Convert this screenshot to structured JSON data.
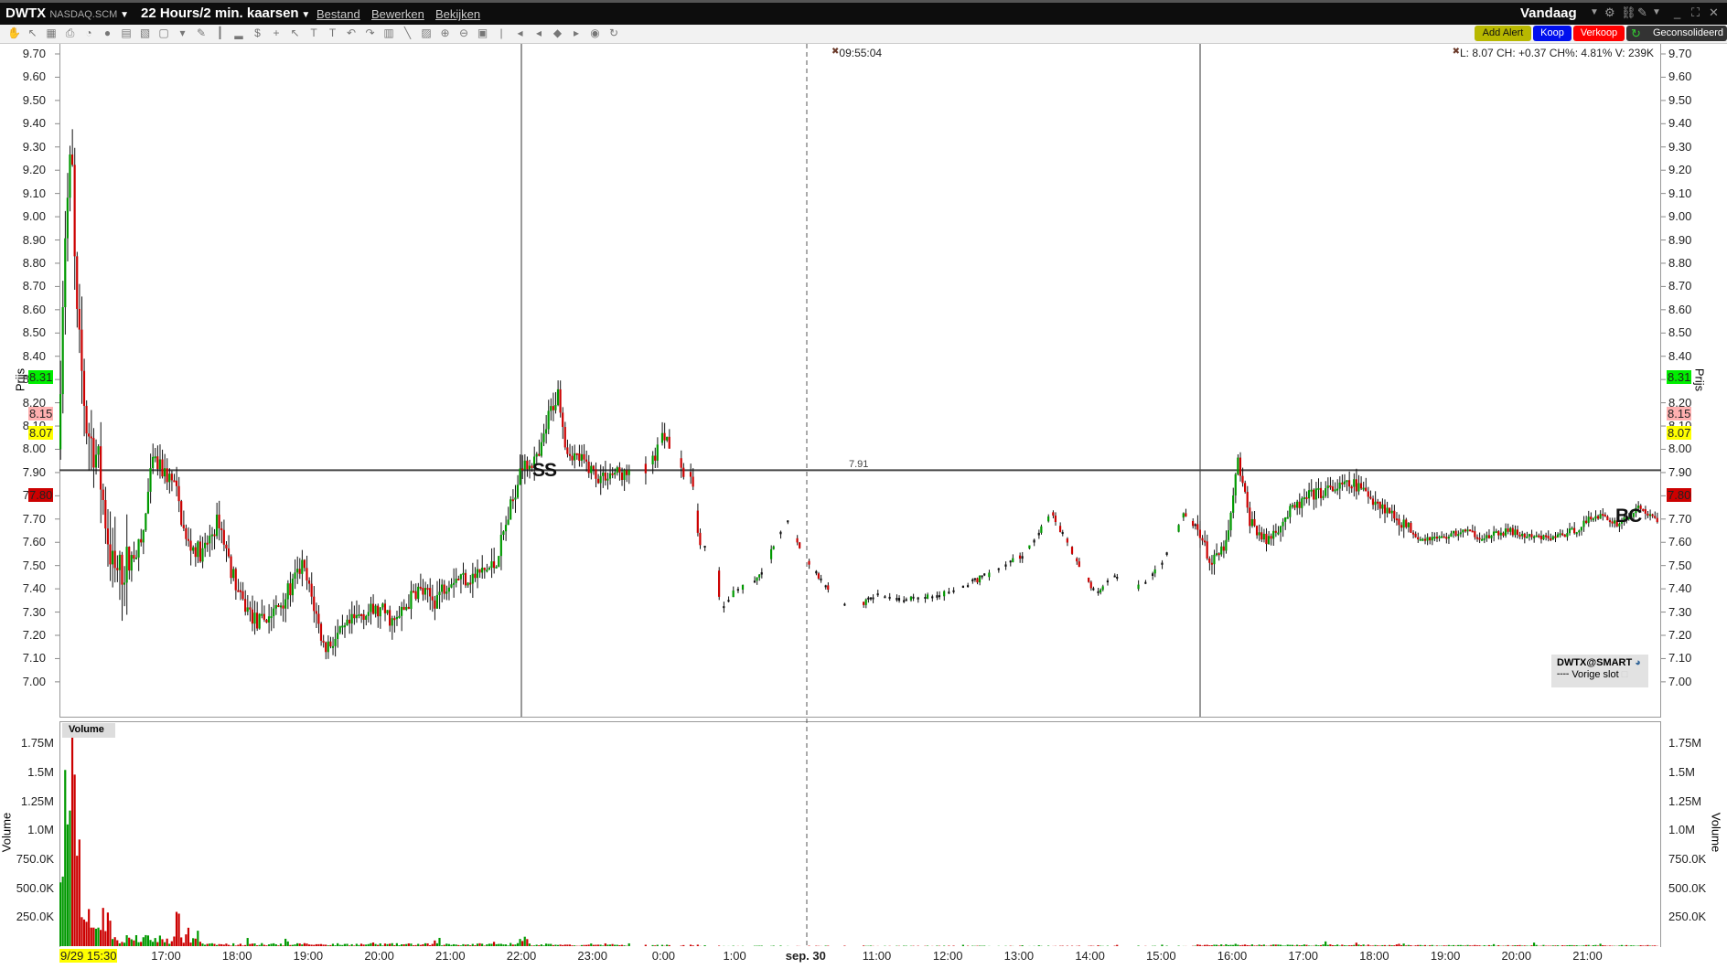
{
  "titlebar": {
    "symbol": "DWTX",
    "exchange": "NASDAQ.SCM",
    "period": "22 Hours/2 min. kaarsen",
    "menus": [
      "Bestand",
      "Bewerken",
      "Bekijken"
    ],
    "range": "Vandaag"
  },
  "toolbar_icons": [
    "hand-icon",
    "pointer-icon",
    "grid-icon",
    "print-icon",
    "clock-icon",
    "circle-icon",
    "layout-icon",
    "chart-compare-icon",
    "blank-icon",
    "dropdown-icon",
    "pencil-icon",
    "bar-type-icon",
    "volume-icon",
    "dollar-icon",
    "crosshair-icon",
    "cursor-icon",
    "text-icon",
    "text-tool-icon",
    "undo-icon",
    "redo-icon",
    "fib-icon",
    "trendline-icon",
    "channel-icon",
    "zoom-in-icon",
    "zoom-out-icon",
    "zoom-fit-icon",
    "scroll-left-icon",
    "scroll-left2-icon",
    "scroll-center-icon",
    "scroll-right-icon",
    "share-icon",
    "refresh-icon",
    "wrench-icon"
  ],
  "order_buttons": {
    "add_alert": "Add Alert",
    "buy": "Koop",
    "sell": "Verkoop",
    "consolidated": "Geconsolideerd"
  },
  "info": {
    "quote": "L: 8.07 CH: +0.37 CH%: 4.81% V: 239K",
    "cursor_time": "09:55:04",
    "crosshair_price": "7.91"
  },
  "axis": {
    "price_title": "Prijs",
    "volume_title": "Volume",
    "price_ticks": [
      "9.70",
      "9.60",
      "9.50",
      "9.40",
      "9.30",
      "9.20",
      "9.10",
      "9.00",
      "8.90",
      "8.80",
      "8.70",
      "8.60",
      "8.50",
      "8.40",
      "8.30",
      "8.20",
      "8.10",
      "8.00",
      "7.90",
      "7.80",
      "7.70",
      "7.60",
      "7.50",
      "7.40",
      "7.30",
      "7.20",
      "7.10",
      "7.00"
    ],
    "volume_ticks": [
      "1.75M",
      "1.5M",
      "1.25M",
      "1.0M",
      "750.0K",
      "500.0K",
      "250.0K"
    ],
    "volume_tick_values": [
      1750000,
      1500000,
      1250000,
      1000000,
      750000,
      500000,
      250000
    ],
    "start_label": "9/29 15:30",
    "time_labels": [
      "17:00",
      "18:00",
      "19:00",
      "20:00",
      "21:00",
      "22:00",
      "23:00",
      "0:00",
      "1:00",
      "sep. 30",
      "11:00",
      "12:00",
      "13:00",
      "14:00",
      "15:00",
      "16:00",
      "17:00",
      "18:00",
      "19:00",
      "20:00",
      "21:00"
    ]
  },
  "price_badges": [
    {
      "text": "8.31",
      "price": 8.31,
      "bg": "#00ee00"
    },
    {
      "text": "8.15",
      "price": 8.15,
      "bg": "#ffb0b0"
    },
    {
      "text": "8.07",
      "price": 8.07,
      "bg": "#ffff00"
    },
    {
      "text": "7.80",
      "price": 7.8,
      "bg": "#cc0000"
    }
  ],
  "annotations": {
    "ss": "SS",
    "bc": "BC"
  },
  "legend": {
    "title": "DWTX@SMART",
    "prev_close": "Vorige slot"
  },
  "volume_label": "Volume",
  "colors": {
    "up": "#009900",
    "down": "#cc0000"
  },
  "chart_data": {
    "type": "candlestick",
    "interval_minutes": 2,
    "price_range": [
      6.9,
      9.72
    ],
    "price_path_hours_price": [
      [
        0,
        8.0
      ],
      [
        0.09,
        8.9
      ],
      [
        0.19,
        9.3
      ],
      [
        0.25,
        8.6
      ],
      [
        0.4,
        8.1
      ],
      [
        0.56,
        7.95
      ],
      [
        0.71,
        7.6
      ],
      [
        0.79,
        7.45
      ],
      [
        0.95,
        7.5
      ],
      [
        1.18,
        7.6
      ],
      [
        1.33,
        7.95
      ],
      [
        1.49,
        7.9
      ],
      [
        1.64,
        7.85
      ],
      [
        1.8,
        7.6
      ],
      [
        2.03,
        7.55
      ],
      [
        2.26,
        7.7
      ],
      [
        2.42,
        7.5
      ],
      [
        2.57,
        7.35
      ],
      [
        2.81,
        7.25
      ],
      [
        3.04,
        7.3
      ],
      [
        3.27,
        7.4
      ],
      [
        3.43,
        7.5
      ],
      [
        3.58,
        7.35
      ],
      [
        3.74,
        7.15
      ],
      [
        3.97,
        7.2
      ],
      [
        4.28,
        7.3
      ],
      [
        4.59,
        7.3
      ],
      [
        4.74,
        7.25
      ],
      [
        5.05,
        7.4
      ],
      [
        5.29,
        7.35
      ],
      [
        5.52,
        7.45
      ],
      [
        5.83,
        7.45
      ],
      [
        6.14,
        7.5
      ],
      [
        6.37,
        7.75
      ],
      [
        6.53,
        7.95
      ],
      [
        6.76,
        7.95
      ],
      [
        6.91,
        8.15
      ],
      [
        7.04,
        8.25
      ],
      [
        7.15,
        8.0
      ],
      [
        7.38,
        7.95
      ],
      [
        7.61,
        7.88
      ],
      [
        7.84,
        7.9
      ],
      [
        8.08,
        7.88
      ],
      [
        8.31,
        7.92
      ],
      [
        8.54,
        8.07
      ],
      [
        8.7,
        7.95
      ],
      [
        8.93,
        7.85
      ],
      [
        9.01,
        7.6
      ],
      [
        9.24,
        7.55
      ],
      [
        9.32,
        7.32
      ],
      [
        9.55,
        7.4
      ],
      [
        9.86,
        7.45
      ],
      [
        10.02,
        7.55
      ],
      [
        10.25,
        7.7
      ],
      [
        10.48,
        7.55
      ],
      [
        10.71,
        7.45
      ],
      [
        10.95,
        7.33
      ],
      [
        11.26,
        7.33
      ],
      [
        11.57,
        7.38
      ],
      [
        11.88,
        7.35
      ],
      [
        12.5,
        7.38
      ],
      [
        12.81,
        7.42
      ],
      [
        13.19,
        7.48
      ],
      [
        13.58,
        7.55
      ],
      [
        13.97,
        7.72
      ],
      [
        14.28,
        7.55
      ],
      [
        14.59,
        7.38
      ],
      [
        14.82,
        7.45
      ],
      [
        15.13,
        7.4
      ],
      [
        15.36,
        7.45
      ],
      [
        15.6,
        7.55
      ],
      [
        15.83,
        7.72
      ],
      [
        16.06,
        7.65
      ],
      [
        16.22,
        7.5
      ],
      [
        16.45,
        7.6
      ],
      [
        16.6,
        7.95
      ],
      [
        16.76,
        7.7
      ],
      [
        16.99,
        7.6
      ],
      [
        17.3,
        7.72
      ],
      [
        17.61,
        7.8
      ],
      [
        17.92,
        7.83
      ],
      [
        18.23,
        7.85
      ],
      [
        18.54,
        7.78
      ],
      [
        18.85,
        7.7
      ],
      [
        19.16,
        7.62
      ],
      [
        19.47,
        7.62
      ],
      [
        19.78,
        7.65
      ],
      [
        20.09,
        7.62
      ],
      [
        20.4,
        7.65
      ],
      [
        20.71,
        7.62
      ],
      [
        21.02,
        7.62
      ],
      [
        21.33,
        7.65
      ],
      [
        21.64,
        7.72
      ],
      [
        21.95,
        7.68
      ],
      [
        22.26,
        7.75
      ],
      [
        22.53,
        7.68
      ]
    ],
    "first_volumes": [
      550000,
      600000,
      1520000,
      1050000,
      1170000,
      1850000,
      1480000,
      780000,
      920000,
      250000,
      230000,
      210000,
      320000,
      160000,
      160000,
      150000,
      160000,
      140000,
      330000,
      130000,
      290000,
      220000
    ],
    "volume_range": [
      0,
      1900000
    ]
  }
}
